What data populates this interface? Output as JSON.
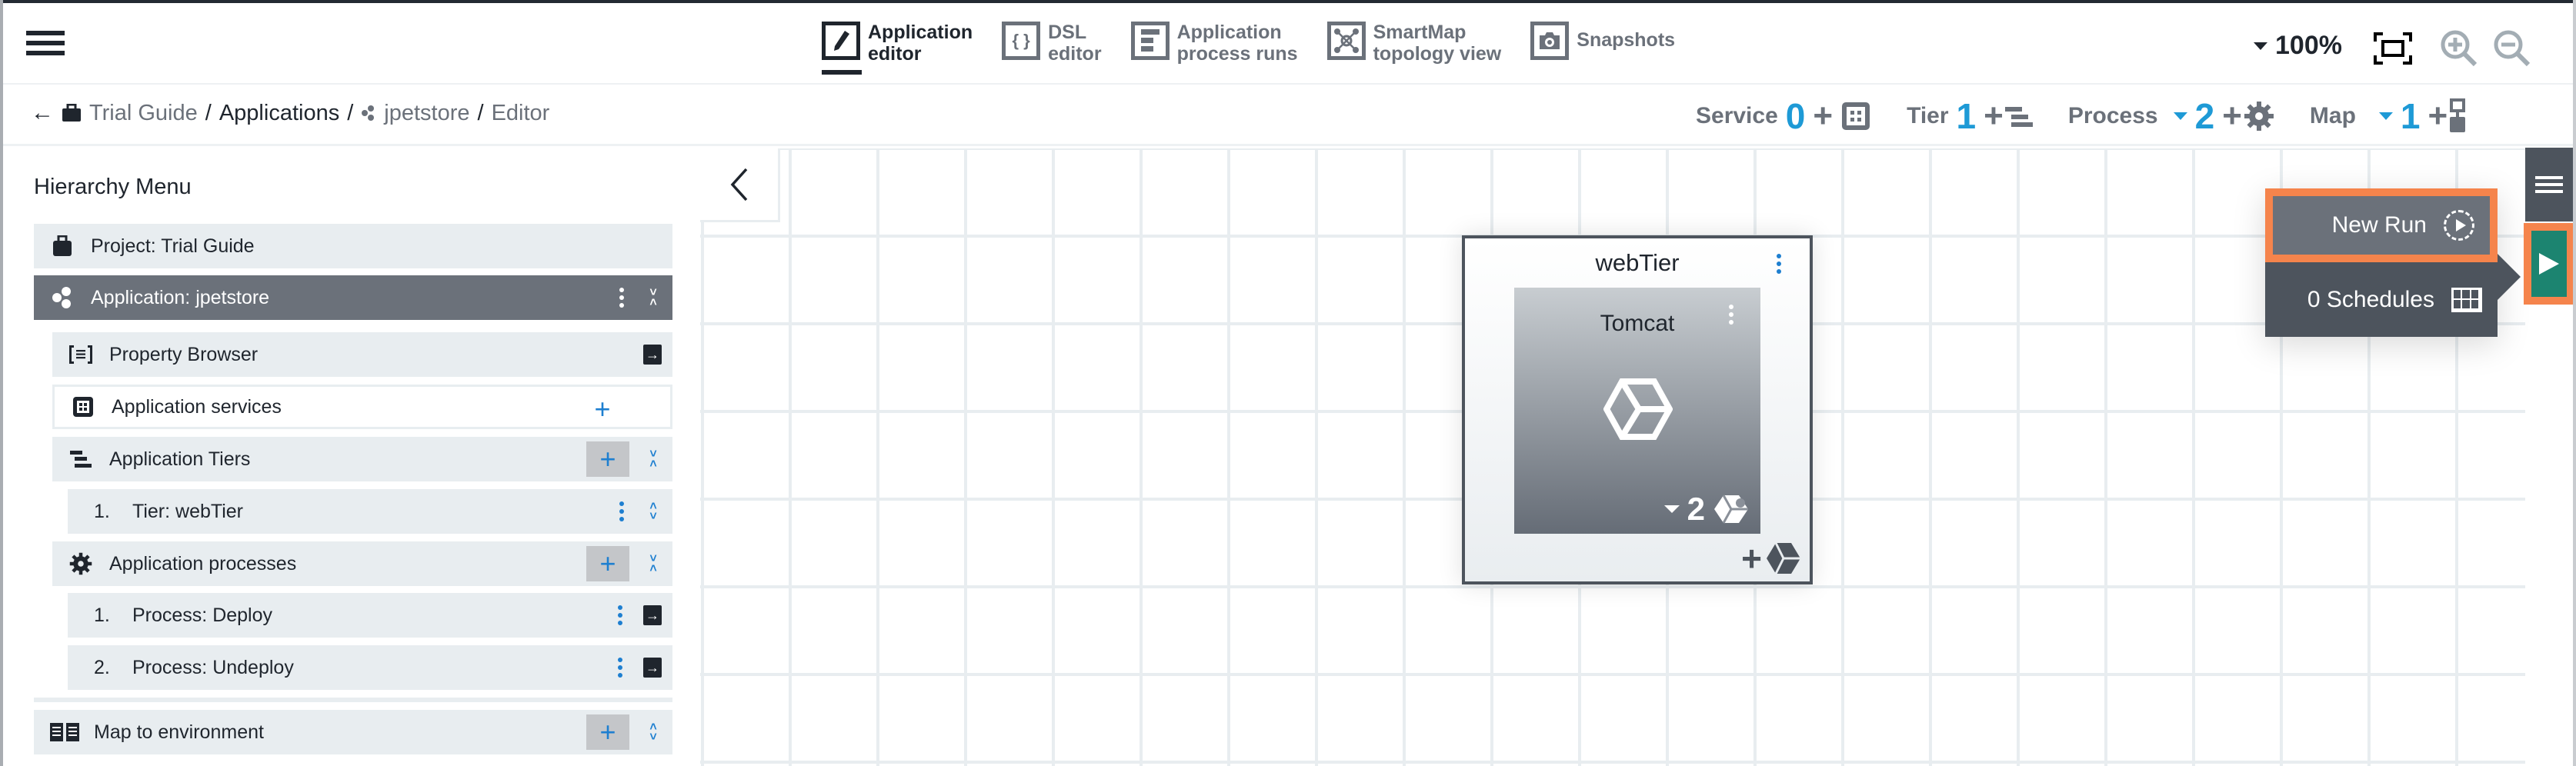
{
  "nav": {
    "menu_icon": "hamburger-icon",
    "tabs": [
      {
        "line1": "Application",
        "line2": "editor",
        "icon": "pencil-icon",
        "active": true
      },
      {
        "line1": "DSL",
        "line2": "editor",
        "icon": "braces-icon",
        "active": false
      },
      {
        "line1": "Application",
        "line2": "process runs",
        "icon": "list-icon",
        "active": false
      },
      {
        "line1": "SmartMap",
        "line2": "topology view",
        "icon": "topology-icon",
        "active": false
      },
      {
        "line1": "Snapshots",
        "line2": "",
        "icon": "camera-icon",
        "active": false
      }
    ],
    "zoom_level": "100%"
  },
  "breadcrumb": {
    "back": "←",
    "project": "Trial Guide",
    "sep": "/",
    "applications": "Applications",
    "app": "jpetstore",
    "page": "Editor"
  },
  "counters": {
    "service": {
      "label": "Service",
      "count": "0",
      "plus": "+"
    },
    "tier": {
      "label": "Tier",
      "count": "1",
      "plus": "+"
    },
    "process": {
      "label": "Process",
      "count": "2",
      "plus": "+"
    },
    "map": {
      "label": "Map",
      "count": "1",
      "plus": "+"
    }
  },
  "sidebar": {
    "title": "Hierarchy Menu",
    "project": "Project: Trial Guide",
    "application": "Application: jpetstore",
    "property_browser": "Property Browser",
    "services": "Application services",
    "tiers": "Application Tiers",
    "tier_items": [
      {
        "num": "1.",
        "label": "Tier: webTier"
      }
    ],
    "processes": "Application processes",
    "process_items": [
      {
        "num": "1.",
        "label": "Process: Deploy"
      },
      {
        "num": "2.",
        "label": "Process: Undeploy"
      }
    ],
    "map": "Map to environment",
    "plus": "+"
  },
  "canvas": {
    "tier": {
      "name": "webTier",
      "component": {
        "name": "Tomcat",
        "process_count": "2"
      },
      "add_plus": "+"
    }
  },
  "run_popup": {
    "new_run": "New Run",
    "schedules": "0 Schedules"
  },
  "colors": {
    "accent": "#1e9ad6",
    "run_green": "#1c8470",
    "highlight_orange": "#f5844c",
    "dark": "#4d545d"
  }
}
